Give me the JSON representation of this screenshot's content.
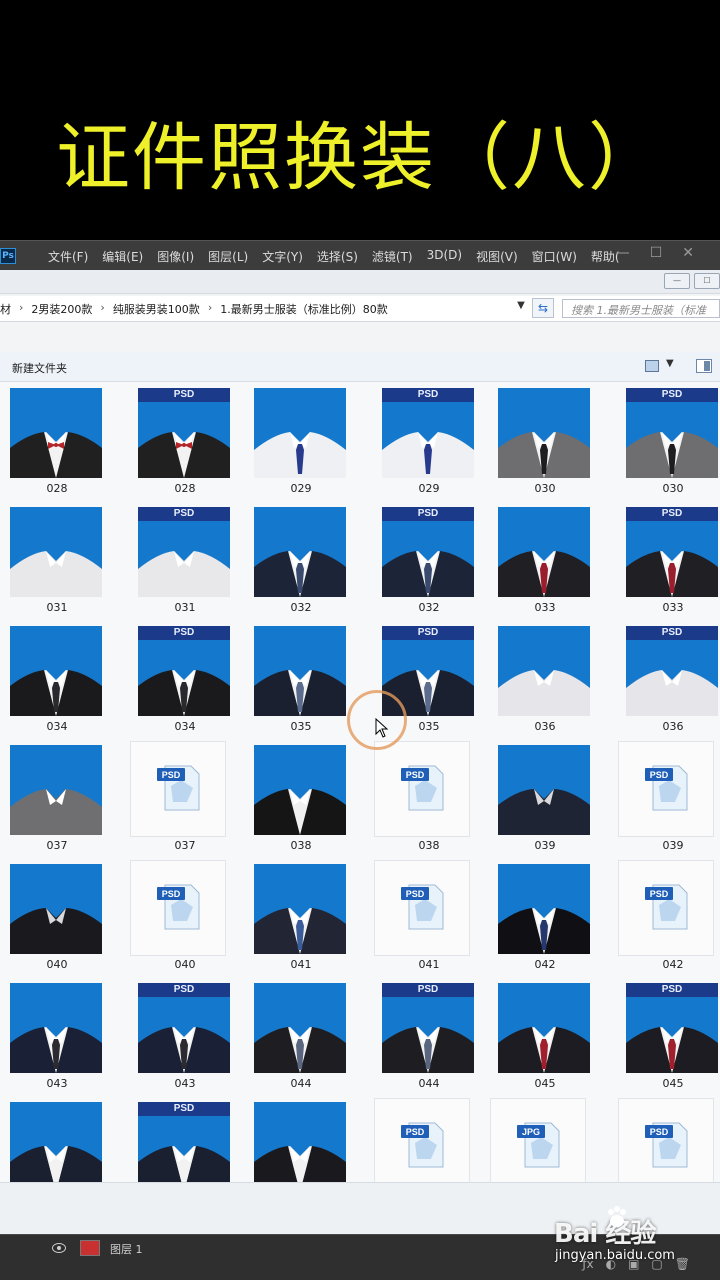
{
  "title": "证件照换装（八）",
  "photoshop": {
    "logo": "Ps",
    "menu": [
      "文件(F)",
      "编辑(E)",
      "图像(I)",
      "图层(L)",
      "文字(Y)",
      "选择(S)",
      "滤镜(T)",
      "3D(D)",
      "视图(V)",
      "窗口(W)",
      "帮助("
    ],
    "window_controls": [
      "—",
      "☐",
      "✕"
    ]
  },
  "explorer": {
    "breadcrumbs": [
      "材",
      "2男装200款",
      "纯服装男装100款",
      "1.最新男士服装（标准比例）80款"
    ],
    "breadcrumb_sep": "›",
    "search_placeholder": "搜索 1.最新男士服装（标准",
    "new_folder": "新建文件夹",
    "psd_tag": "PSD",
    "jpg_tag": "JPG",
    "files": [
      {
        "label": "028",
        "kind": "thumb",
        "psd": false,
        "shirt": "#f2f2f2",
        "suit": "#202020",
        "tie": "bow",
        "tie_color": "#b3272b"
      },
      {
        "label": "028",
        "kind": "thumb",
        "psd": true,
        "shirt": "#f2f2f2",
        "suit": "#202020",
        "tie": "bow",
        "tie_color": "#b3272b"
      },
      {
        "label": "029",
        "kind": "thumb",
        "psd": false,
        "shirt": "#eef0f3",
        "suit": "none",
        "tie": "tie",
        "tie_color": "#283a8c"
      },
      {
        "label": "029",
        "kind": "thumb",
        "psd": true,
        "shirt": "#eef0f3",
        "suit": "none",
        "tie": "tie",
        "tie_color": "#283a8c"
      },
      {
        "label": "030",
        "kind": "thumb",
        "psd": false,
        "shirt": "#f2f2f2",
        "suit": "#6e6e70",
        "tie": "tie",
        "tie_color": "#1e1e22"
      },
      {
        "label": "030",
        "kind": "thumb",
        "psd": true,
        "shirt": "#f2f2f2",
        "suit": "#6e6e70",
        "tie": "tie",
        "tie_color": "#1e1e22"
      },
      {
        "label": "031",
        "kind": "thumb",
        "psd": false,
        "shirt": "#e8e8ea",
        "suit": "none",
        "tie": "none",
        "tie_color": "#000000"
      },
      {
        "label": "031",
        "kind": "thumb",
        "psd": true,
        "shirt": "#e8e8ea",
        "suit": "none",
        "tie": "none",
        "tie_color": "#000000"
      },
      {
        "label": "032",
        "kind": "thumb",
        "psd": false,
        "shirt": "#f2f2f2",
        "suit": "#1c2438",
        "tie": "tie",
        "tie_color": "#3a4a6e"
      },
      {
        "label": "032",
        "kind": "thumb",
        "psd": true,
        "shirt": "#f2f2f2",
        "suit": "#1c2438",
        "tie": "tie",
        "tie_color": "#3a4a6e"
      },
      {
        "label": "033",
        "kind": "thumb",
        "psd": false,
        "shirt": "#f2f2f2",
        "suit": "#1f1f24",
        "tie": "tie",
        "tie_color": "#9a1e2c"
      },
      {
        "label": "033",
        "kind": "thumb",
        "psd": true,
        "shirt": "#f2f2f2",
        "suit": "#1f1f24",
        "tie": "tie",
        "tie_color": "#9a1e2c"
      },
      {
        "label": "034",
        "kind": "thumb",
        "psd": false,
        "shirt": "#f2f2f2",
        "suit": "#1a1a1c",
        "tie": "tie",
        "tie_color": "#2a2a2e"
      },
      {
        "label": "034",
        "kind": "thumb",
        "psd": true,
        "shirt": "#f2f2f2",
        "suit": "#1a1a1c",
        "tie": "tie",
        "tie_color": "#2a2a2e"
      },
      {
        "label": "035",
        "kind": "thumb",
        "psd": false,
        "shirt": "#f2f2f2",
        "suit": "#1b2030",
        "tie": "tie",
        "tie_color": "#5a6b8e"
      },
      {
        "label": "035",
        "kind": "thumb",
        "psd": true,
        "shirt": "#f2f2f2",
        "suit": "#1b2030",
        "tie": "tie",
        "tie_color": "#5a6b8e"
      },
      {
        "label": "036",
        "kind": "thumb",
        "psd": false,
        "shirt": "#e6e6ea",
        "suit": "none",
        "tie": "none",
        "tie_color": "#000000"
      },
      {
        "label": "036",
        "kind": "thumb",
        "psd": true,
        "shirt": "#e6e6ea",
        "suit": "none",
        "tie": "none",
        "tie_color": "#000000"
      },
      {
        "label": "037",
        "kind": "thumb",
        "psd": false,
        "shirt": "#6f6f72",
        "suit": "none",
        "tie": "none",
        "tie_color": "#000000"
      },
      {
        "label": "037",
        "kind": "doc",
        "psd": true
      },
      {
        "label": "038",
        "kind": "thumb",
        "psd": false,
        "shirt": "#f0f0f0",
        "suit": "#151515",
        "tie": "none",
        "tie_color": "#000000"
      },
      {
        "label": "038",
        "kind": "doc",
        "psd": true
      },
      {
        "label": "039",
        "kind": "thumb",
        "psd": false,
        "shirt": "#1e2434",
        "suit": "#1e2434",
        "tie": "none",
        "tie_color": "#000000"
      },
      {
        "label": "039",
        "kind": "doc",
        "psd": true
      },
      {
        "label": "040",
        "kind": "thumb",
        "psd": false,
        "shirt": "#1a1a1e",
        "suit": "#1a1a1e",
        "tie": "none",
        "tie_color": "#000000"
      },
      {
        "label": "040",
        "kind": "doc",
        "psd": true
      },
      {
        "label": "041",
        "kind": "thumb",
        "psd": false,
        "shirt": "#f2f2f2",
        "suit": "#222634",
        "tie": "tie",
        "tie_color": "#3b5c9a"
      },
      {
        "label": "041",
        "kind": "doc",
        "psd": true
      },
      {
        "label": "042",
        "kind": "thumb",
        "psd": false,
        "shirt": "#f2f2f2",
        "suit": "#101014",
        "tie": "tie",
        "tie_color": "#24386e"
      },
      {
        "label": "042",
        "kind": "doc",
        "psd": true
      },
      {
        "label": "043",
        "kind": "thumb",
        "psd": false,
        "shirt": "#f2f2f2",
        "suit": "#1a2036",
        "tie": "tie",
        "tie_color": "#2a2a30"
      },
      {
        "label": "043",
        "kind": "thumb",
        "psd": true,
        "shirt": "#f2f2f2",
        "suit": "#1a2036",
        "tie": "tie",
        "tie_color": "#2a2a30"
      },
      {
        "label": "044",
        "kind": "thumb",
        "psd": false,
        "shirt": "#f2f2f2",
        "suit": "#1e1e22",
        "tie": "tie",
        "tie_color": "#5a6680"
      },
      {
        "label": "044",
        "kind": "thumb",
        "psd": true,
        "shirt": "#f2f2f2",
        "suit": "#1e1e22",
        "tie": "tie",
        "tie_color": "#5a6680"
      },
      {
        "label": "045",
        "kind": "thumb",
        "psd": false,
        "shirt": "#f2f2f2",
        "suit": "#1c1c22",
        "tie": "tie",
        "tie_color": "#a0202e"
      },
      {
        "label": "045",
        "kind": "thumb",
        "psd": true,
        "shirt": "#f2f2f2",
        "suit": "#1c1c22",
        "tie": "tie",
        "tie_color": "#a0202e"
      },
      {
        "label": "",
        "kind": "thumb",
        "psd": false,
        "shirt": "#f2f2f2",
        "suit": "#1a2030",
        "tie": "none",
        "tie_color": "#000000"
      },
      {
        "label": "",
        "kind": "thumb",
        "psd": true,
        "shirt": "#f2f2f2",
        "suit": "#1a2030",
        "tie": "none",
        "tie_color": "#000000"
      },
      {
        "label": "",
        "kind": "thumb",
        "psd": false,
        "shirt": "#f2f2f2",
        "suit": "#1a1a1e",
        "tie": "none",
        "tie_color": "#000000"
      },
      {
        "label": "",
        "kind": "doc",
        "psd": true
      },
      {
        "label": "",
        "kind": "doc",
        "psd": false
      },
      {
        "label": "",
        "kind": "doc",
        "psd": true
      }
    ]
  },
  "layers": {
    "layer_name": "图层 1",
    "tools": [
      "ƒx",
      "◐",
      "▣",
      "▢",
      "🗑"
    ]
  },
  "watermark": {
    "logo": "Bai  经验",
    "url": "jingyan.baidu.com"
  },
  "colors": {
    "title": "#eef02a",
    "photo_bg": "#1478cc",
    "psd_tag": "#1c3a8a"
  }
}
